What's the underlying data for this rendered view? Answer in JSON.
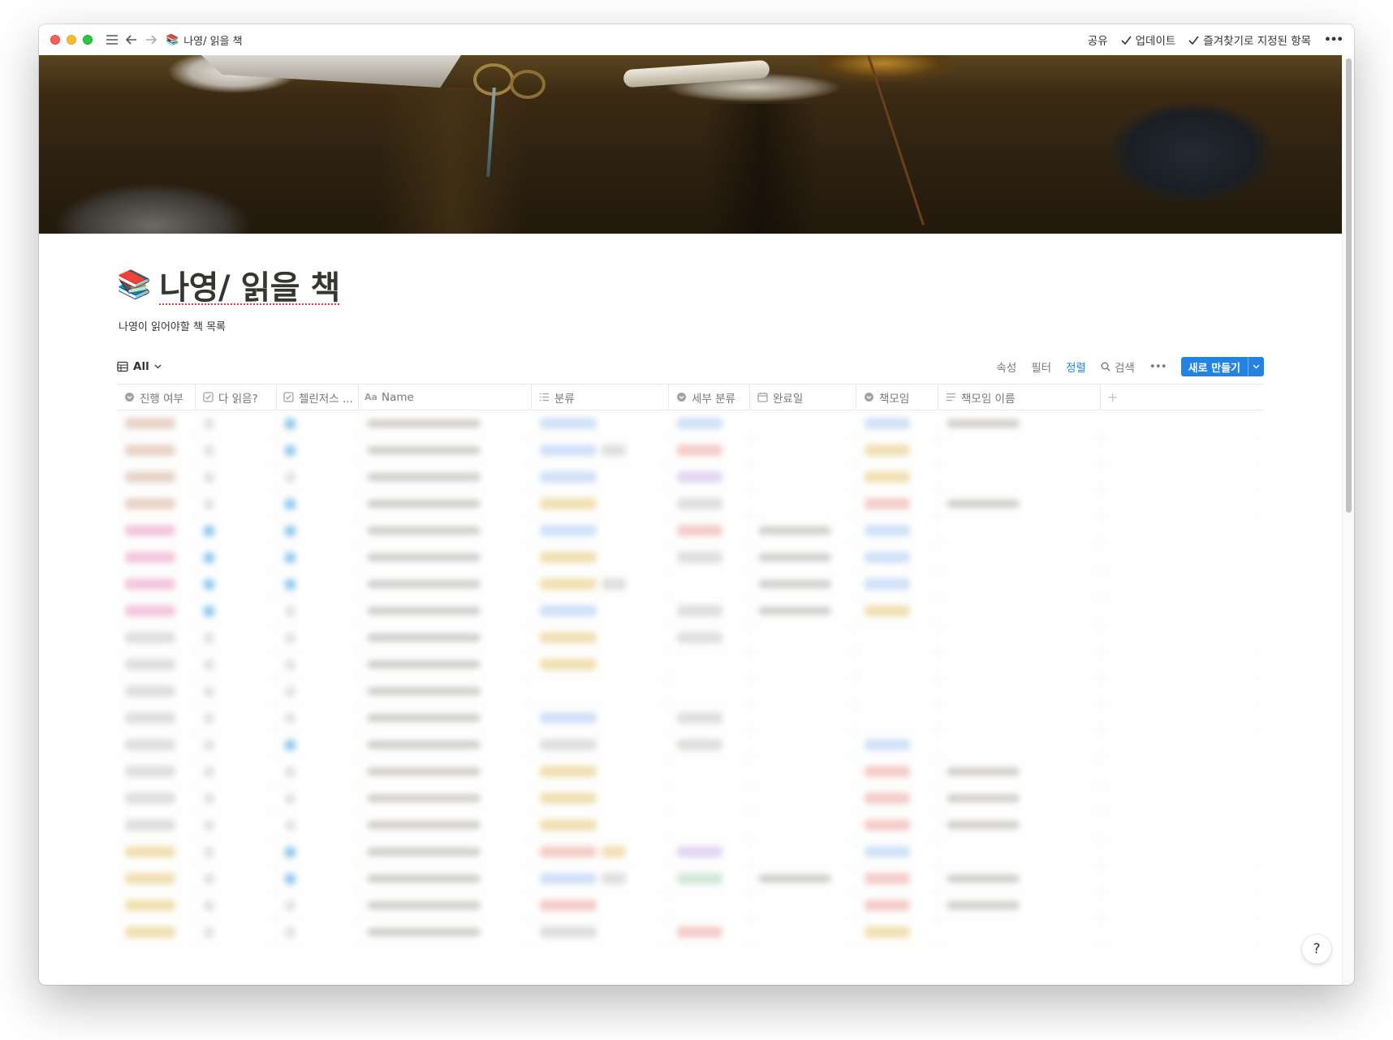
{
  "window": {
    "breadcrumb_emoji": "📚",
    "breadcrumb_title": "나영/ 읽을 책",
    "share_label": "공유",
    "updates_label": "업데이트",
    "favorites_label": "즐겨찾기로 지정된 항목",
    "more_label": "•••"
  },
  "page": {
    "emoji": "📚",
    "title": "나영/ 읽을 책",
    "description": "나영이 읽어야할 책 목록"
  },
  "view": {
    "tab_label": "All",
    "properties_label": "속성",
    "filter_label": "필터",
    "sort_label": "정렬",
    "search_label": "검색",
    "more_label": "•••",
    "new_label": "새로 만들기"
  },
  "table": {
    "columns": [
      {
        "label": "진행 여부",
        "icon": "select-icon"
      },
      {
        "label": "다 읽음?",
        "icon": "checkbox-icon"
      },
      {
        "label": "첼린저스 ...",
        "icon": "checkbox-icon"
      },
      {
        "label": "Name",
        "icon": "text-aa-icon"
      },
      {
        "label": "분류",
        "icon": "list-icon"
      },
      {
        "label": "세부 분류",
        "icon": "select-icon"
      },
      {
        "label": "완료일",
        "icon": "calendar-icon"
      },
      {
        "label": "책모임",
        "icon": "select-icon"
      },
      {
        "label": "책모임 이름",
        "icon": "text-lines-icon"
      }
    ],
    "add_column_label": "+"
  },
  "help_label": "?",
  "colors": {
    "accent": "#2383e2",
    "pill_brown": "#e8d2c5",
    "pill_pink": "#f2c6dd",
    "pill_yellow": "#f0dfb1",
    "pill_blue": "#cfe0f7",
    "pill_red": "#f4cbc7",
    "pill_purple": "#e2d5f2",
    "pill_green": "#cfe8d6",
    "pill_gray": "#dfdedc"
  }
}
